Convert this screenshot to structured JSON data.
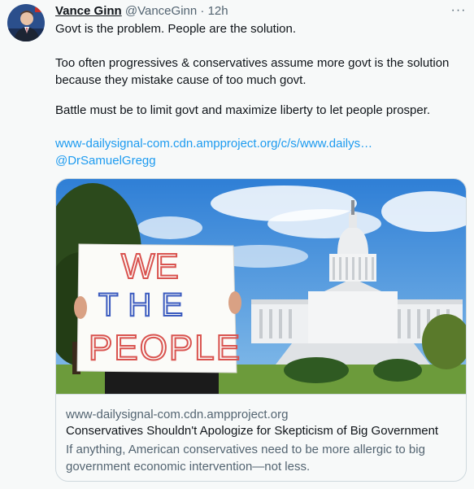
{
  "tweet": {
    "author": {
      "name": "Vance Ginn",
      "handle": "@VanceGinn",
      "separator": "·",
      "time": "12h"
    },
    "more_label": "···",
    "lines": [
      "Govt is the problem. People are the solution.",
      "Too often progressives & conservatives assume more govt is the solution",
      "because they mistake cause of too much govt.",
      "Battle must be to limit govt and maximize liberty to let people prosper."
    ],
    "url_text": "www-dailysignal-com.cdn.ampproject.org/c/s/www.dailys…",
    "mention": "@DrSamuelGregg",
    "card": {
      "sign_text": [
        "WE",
        "THE",
        "PEOPLE"
      ],
      "domain": "www-dailysignal-com.cdn.ampproject.org",
      "title": "Conservatives Shouldn't Apologize for Skepticism of Big Government",
      "description": "If anything, American conservatives need to be more allergic to big government economic intervention—not less."
    }
  },
  "colors": {
    "background": "#f7f9f9",
    "text": "#0f1419",
    "secondary": "#536471",
    "link": "#1d9bf0",
    "border": "#cfd9de"
  },
  "icons": {
    "avatar": "profile-photo",
    "more": "ellipsis-icon"
  }
}
